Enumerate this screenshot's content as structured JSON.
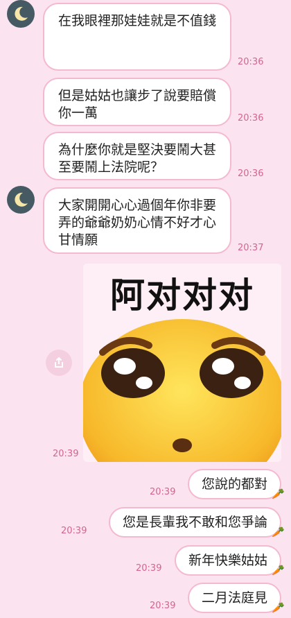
{
  "messages_in": [
    {
      "text": "在我眼裡那娃娃就是不值錢",
      "time": "20:36"
    },
    {
      "text": "但是姑姑也讓步了說要賠償你一萬",
      "time": "20:36"
    },
    {
      "text": "為什麼你就是堅決要鬧大甚至要鬧上法院呢？",
      "time": "20:36"
    },
    {
      "text": "大家開開心心過個年你非要弄的爺爺奶奶心情不好才心甘情願",
      "time": "20:37"
    }
  ],
  "sticker": {
    "text": "阿对对对",
    "time": "20:39"
  },
  "messages_out": [
    {
      "text": "您說的都對",
      "time": "20:39"
    },
    {
      "text": "您是長輩我不敢和您爭論",
      "time": "20:39"
    },
    {
      "text": "新年快樂姑姑",
      "time": "20:39"
    },
    {
      "text": "二月法庭見",
      "time": "20:39"
    }
  ],
  "icons": {
    "avatar": "crescent-moon-icon",
    "share": "share-icon",
    "reaction": "carrot-icon"
  },
  "colors": {
    "background": "#fbe4ef",
    "bubble_border": "#f4b8cf",
    "time_text": "#d3648f",
    "avatar_bg": "#465a63"
  }
}
